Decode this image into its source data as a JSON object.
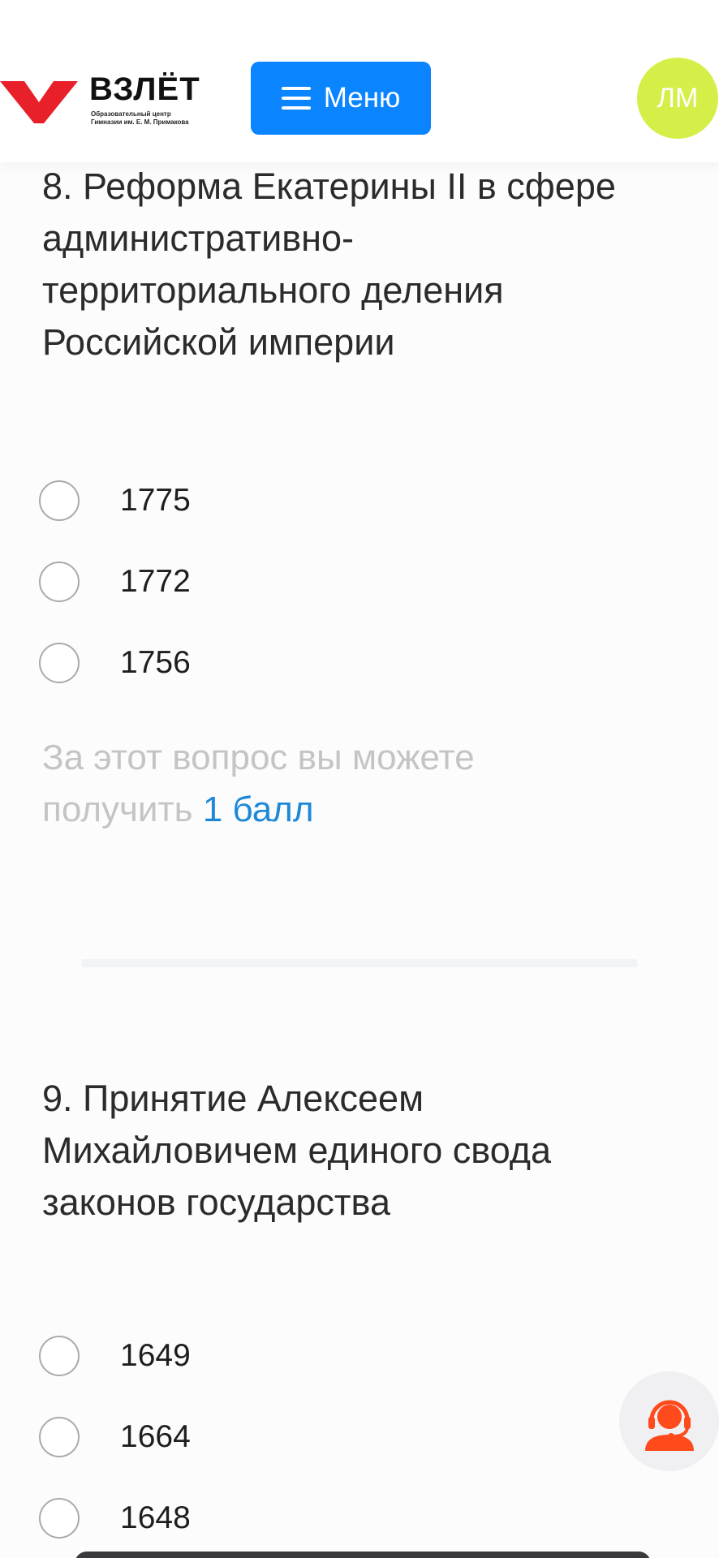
{
  "header": {
    "logo_title": "ВЗЛЁТ",
    "logo_subtitle_line1": "Образовательный центр",
    "logo_subtitle_line2": "Гимназии им. Е. М. Примакова",
    "menu_label": "Меню",
    "avatar_initials": "ЛМ",
    "colors": {
      "logo_red": "#e8202a",
      "menu_blue": "#0a84ff",
      "avatar_lime": "#d6ef48"
    }
  },
  "questions": [
    {
      "title": "8. Реформа Екатерины II в сфере административно-территориального деления Российской империи",
      "title_lines": [
        "8. Реформа Екатерины II в сфере",
        "административно-",
        "территориального деления",
        "Российской империи"
      ],
      "options": [
        "1775",
        "1772",
        "1756"
      ],
      "points_text": "За этот вопрос вы можете получить",
      "points_text_line1": "За этот вопрос вы можете",
      "points_text_line2": "получить",
      "points_value": "1 балл"
    },
    {
      "title": "9. Принятие Алексеем Михайловичем единого свода законов государства",
      "title_lines": [
        "9. Принятие Алексеем",
        "Михайловичем единого свода",
        "законов государства"
      ],
      "options": [
        "1649",
        "1664",
        "1648"
      ]
    }
  ],
  "icons": {
    "support": "headset-support-icon",
    "menu": "hamburger-icon",
    "support_color": "#ff4a1c"
  }
}
